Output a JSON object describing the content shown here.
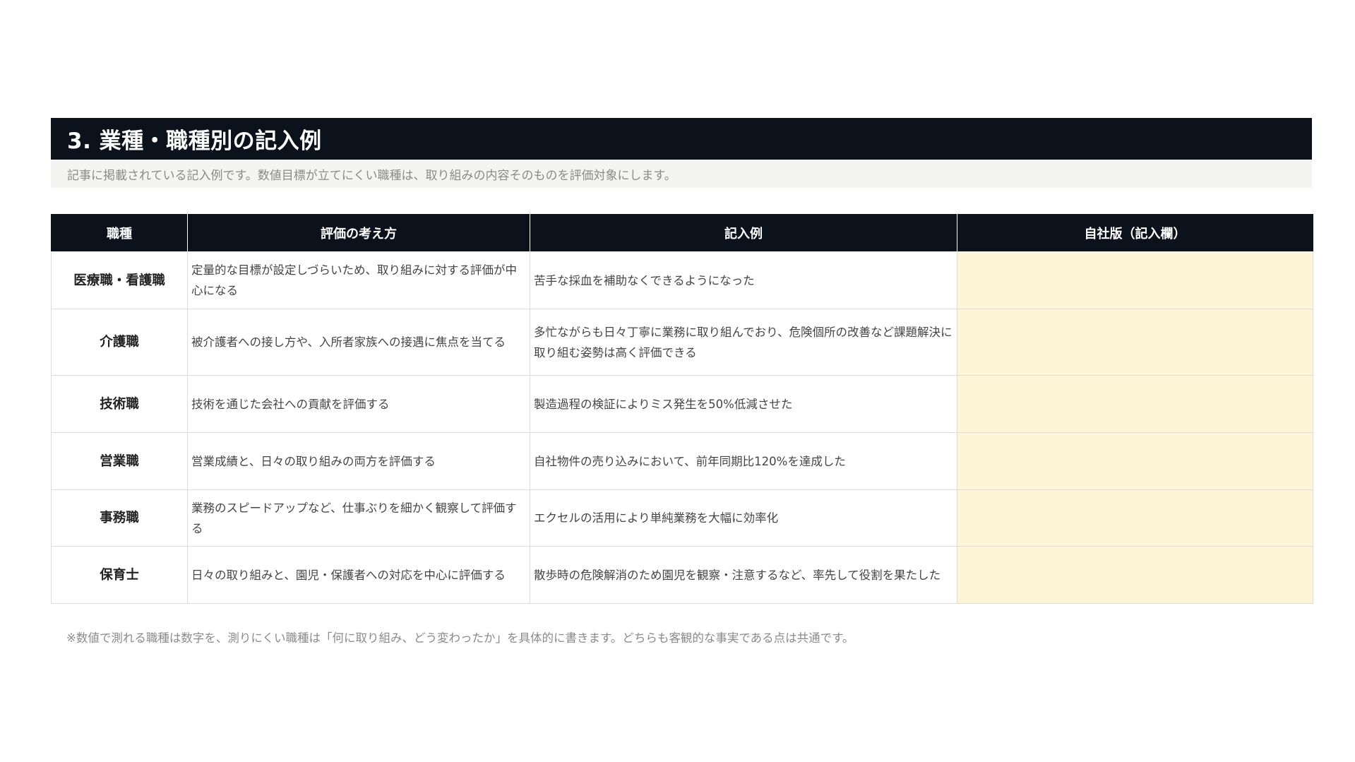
{
  "section": {
    "title": "3. 業種・職種別の記入例",
    "subtitle": "記事に掲載されている記入例です。数値目標が立てにくい職種は、取り組みの内容そのものを評価対象にします。"
  },
  "table": {
    "headers": {
      "job": "職種",
      "approach": "評価の考え方",
      "example": "記入例",
      "own": "自社版（記入欄）"
    },
    "rows": [
      {
        "job": "医療職・看護職",
        "approach": "定量的な目標が設定しづらいため、取り組みに対する評価が中心になる",
        "example": "苦手な採血を補助なくできるようになった",
        "own": ""
      },
      {
        "job": "介護職",
        "approach": "被介護者への接し方や、入所者家族への接遇に焦点を当てる",
        "example": "多忙ながらも日々丁寧に業務に取り組んでおり、危険個所の改善など課題解決に取り組む姿勢は高く評価できる",
        "own": ""
      },
      {
        "job": "技術職",
        "approach": "技術を通じた会社への貢献を評価する",
        "example": "製造過程の検証によりミス発生を50%低減させた",
        "own": ""
      },
      {
        "job": "営業職",
        "approach": "営業成績と、日々の取り組みの両方を評価する",
        "example": "自社物件の売り込みにおいて、前年同期比120%を達成した",
        "own": ""
      },
      {
        "job": "事務職",
        "approach": "業務のスピードアップなど、仕事ぶりを細かく観察して評価する",
        "example": "エクセルの活用により単純業務を大幅に効率化",
        "own": ""
      },
      {
        "job": "保育士",
        "approach": "日々の取り組みと、園児・保護者への対応を中心に評価する",
        "example": "散歩時の危険解消のため園児を観察・注意するなど、率先して役割を果たした",
        "own": ""
      }
    ]
  },
  "note": "※数値で測れる職種は数字を、測りにくい職種は「何に取り組み、どう変わったか」を具体的に書きます。どちらも客観的な事実である点は共通です。",
  "colors": {
    "header_bg": "#0b121b",
    "subtitle_bg": "#f4f4f2",
    "entry_cell_bg": "#fdf5d6"
  }
}
